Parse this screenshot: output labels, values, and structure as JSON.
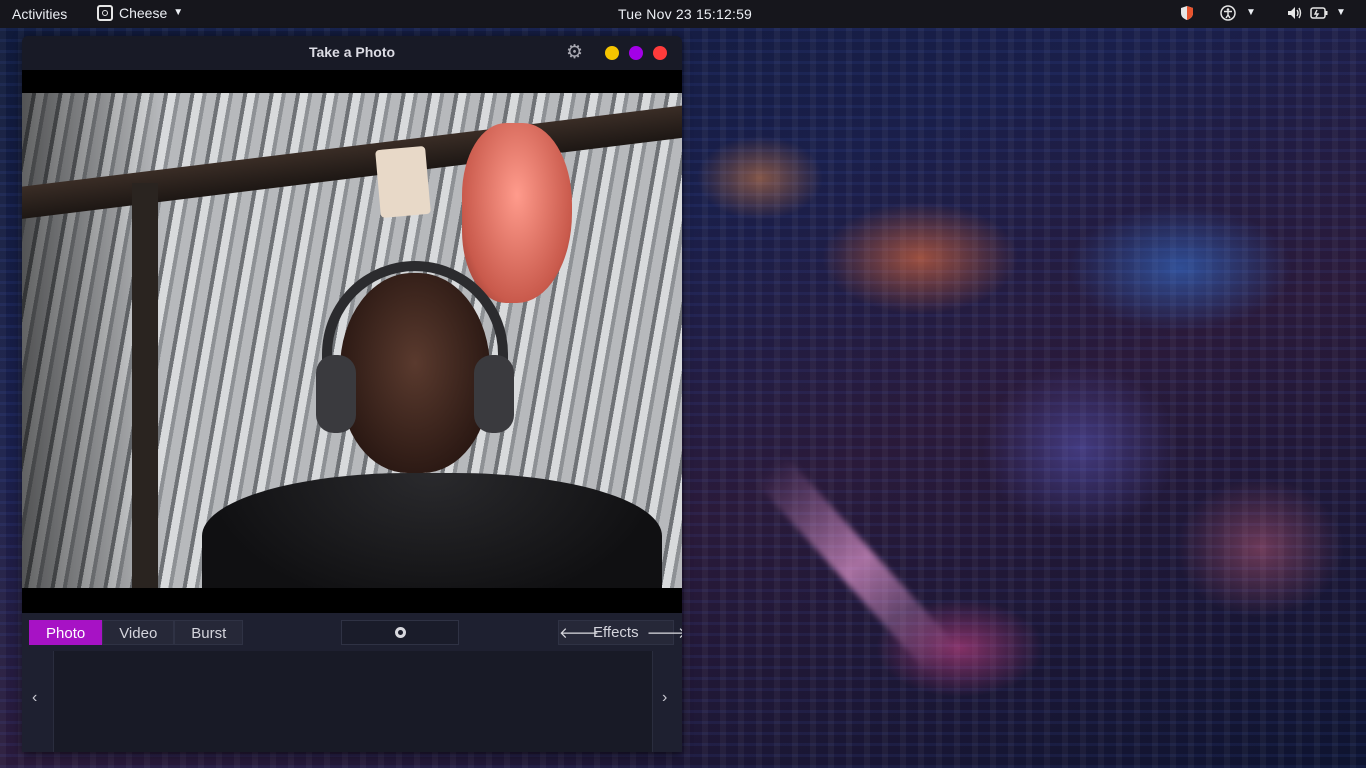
{
  "topbar": {
    "activities": "Activities",
    "app_name": "Cheese",
    "clock": "Tue Nov 23  15:12:59"
  },
  "window": {
    "title": "Take a Photo",
    "controls": {
      "minimize_color": "#f5c400",
      "maximize_color": "#a300e8",
      "close_color": "#ff3b3b"
    }
  },
  "modes": [
    {
      "label": "Photo",
      "active": true
    },
    {
      "label": "Video",
      "active": false
    },
    {
      "label": "Burst",
      "active": false
    }
  ],
  "effects": {
    "prev_icon": "arrow-left-icon",
    "label": "Effects",
    "next_icon": "arrow-right-icon"
  },
  "capture_icon": "webcam-icon",
  "accent_color": "#a712c5",
  "tray_icons": [
    "shield-icon",
    "accessibility-icon",
    "volume-icon",
    "battery-icon"
  ]
}
